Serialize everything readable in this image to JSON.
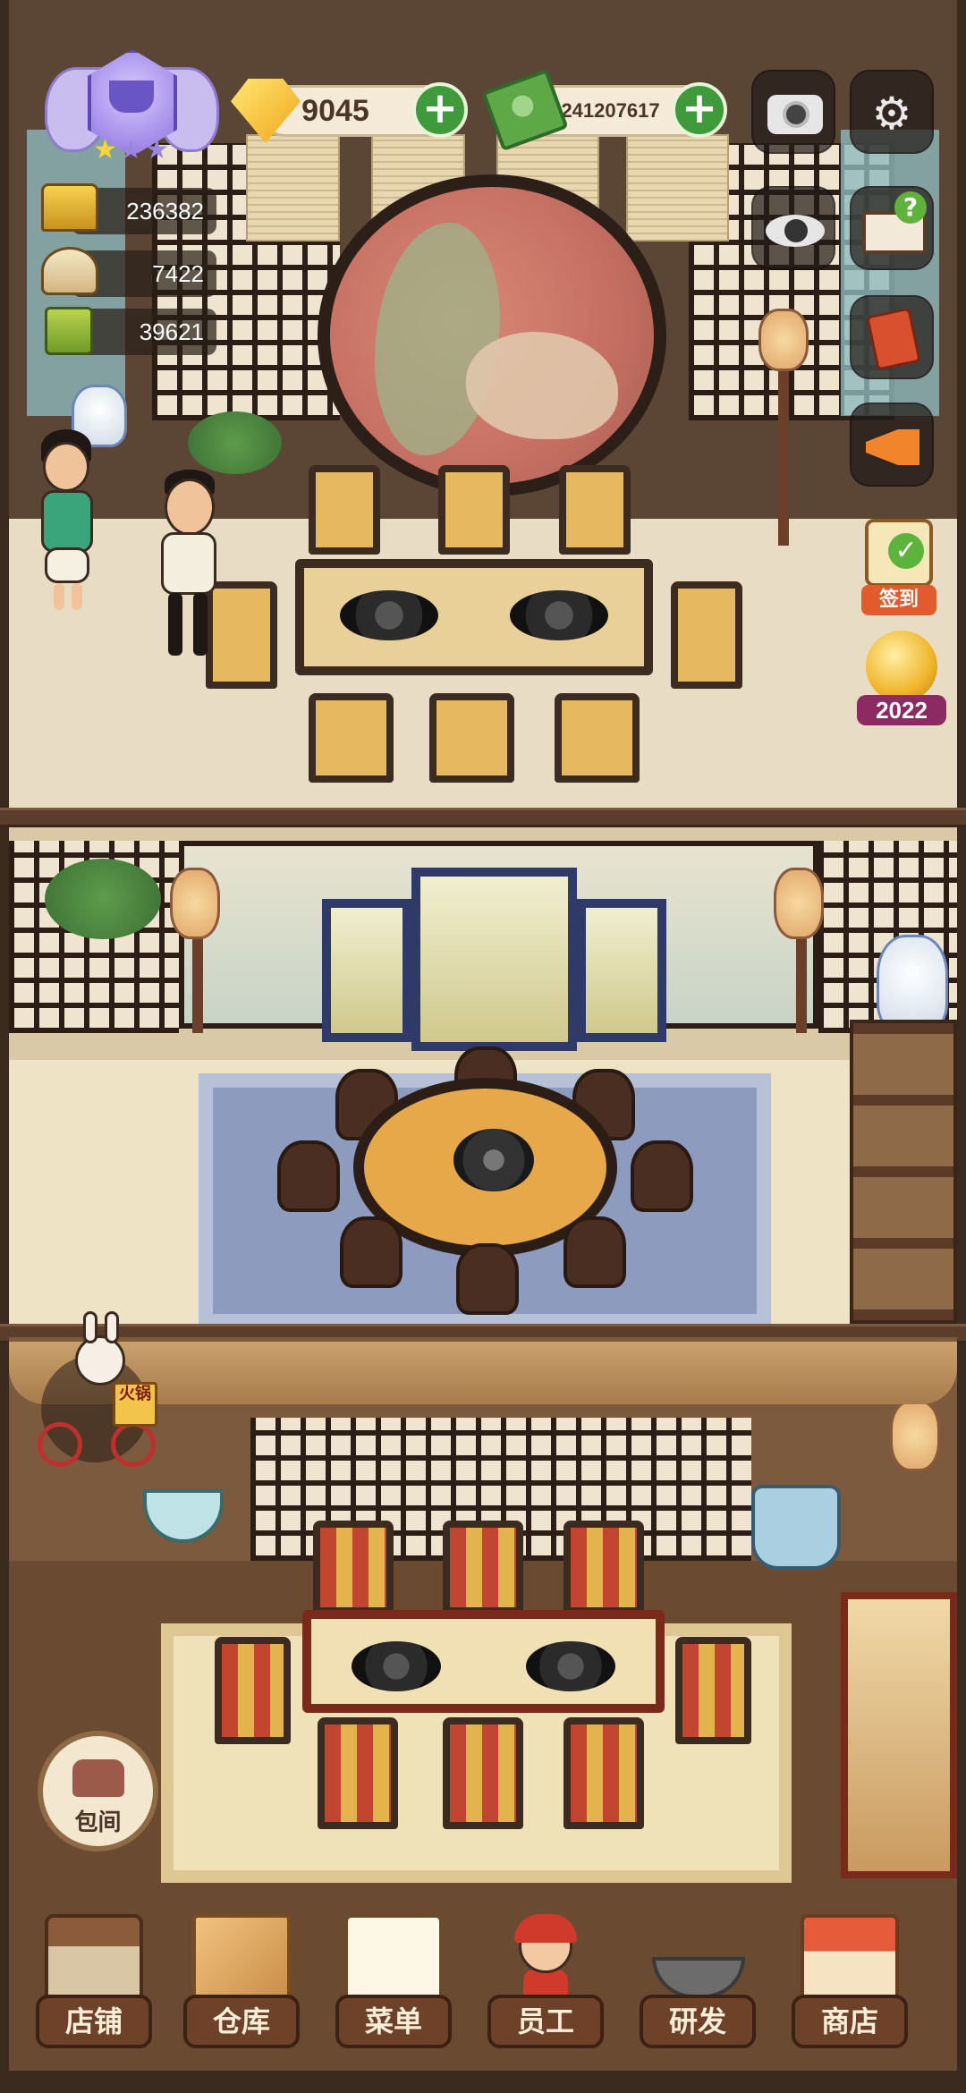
{
  "hud": {
    "rank_stars": [
      true,
      false,
      false
    ],
    "gems": "9045",
    "cash": "241207617",
    "stats": [
      {
        "icon": "gold-pot-icon",
        "value": "236382"
      },
      {
        "icon": "dish-tray-icon",
        "value": "7422"
      },
      {
        "icon": "recipe-book-icon",
        "value": "39621"
      }
    ],
    "side_buttons": [
      {
        "name": "camera-icon"
      },
      {
        "name": "settings-gear-icon"
      },
      {
        "name": "eye-icon"
      },
      {
        "name": "help-book-icon"
      },
      {
        "name": "red-book-icon"
      },
      {
        "name": "megaphone-icon"
      }
    ],
    "checkin_label": "签到",
    "event_year": "2022",
    "delivery_box_text": "火锅",
    "room_button_label": "包间"
  },
  "bottom_nav": [
    {
      "id": "shop",
      "label": "店铺"
    },
    {
      "id": "warehouse",
      "label": "仓库"
    },
    {
      "id": "menu",
      "label": "菜单"
    },
    {
      "id": "staff",
      "label": "员工"
    },
    {
      "id": "research",
      "label": "研发"
    },
    {
      "id": "store",
      "label": "商店"
    }
  ],
  "colors": {
    "plus_button": "#3f9a3b",
    "nav_label_bg": "#6e4129",
    "currency_bg": "#f4ead7"
  }
}
